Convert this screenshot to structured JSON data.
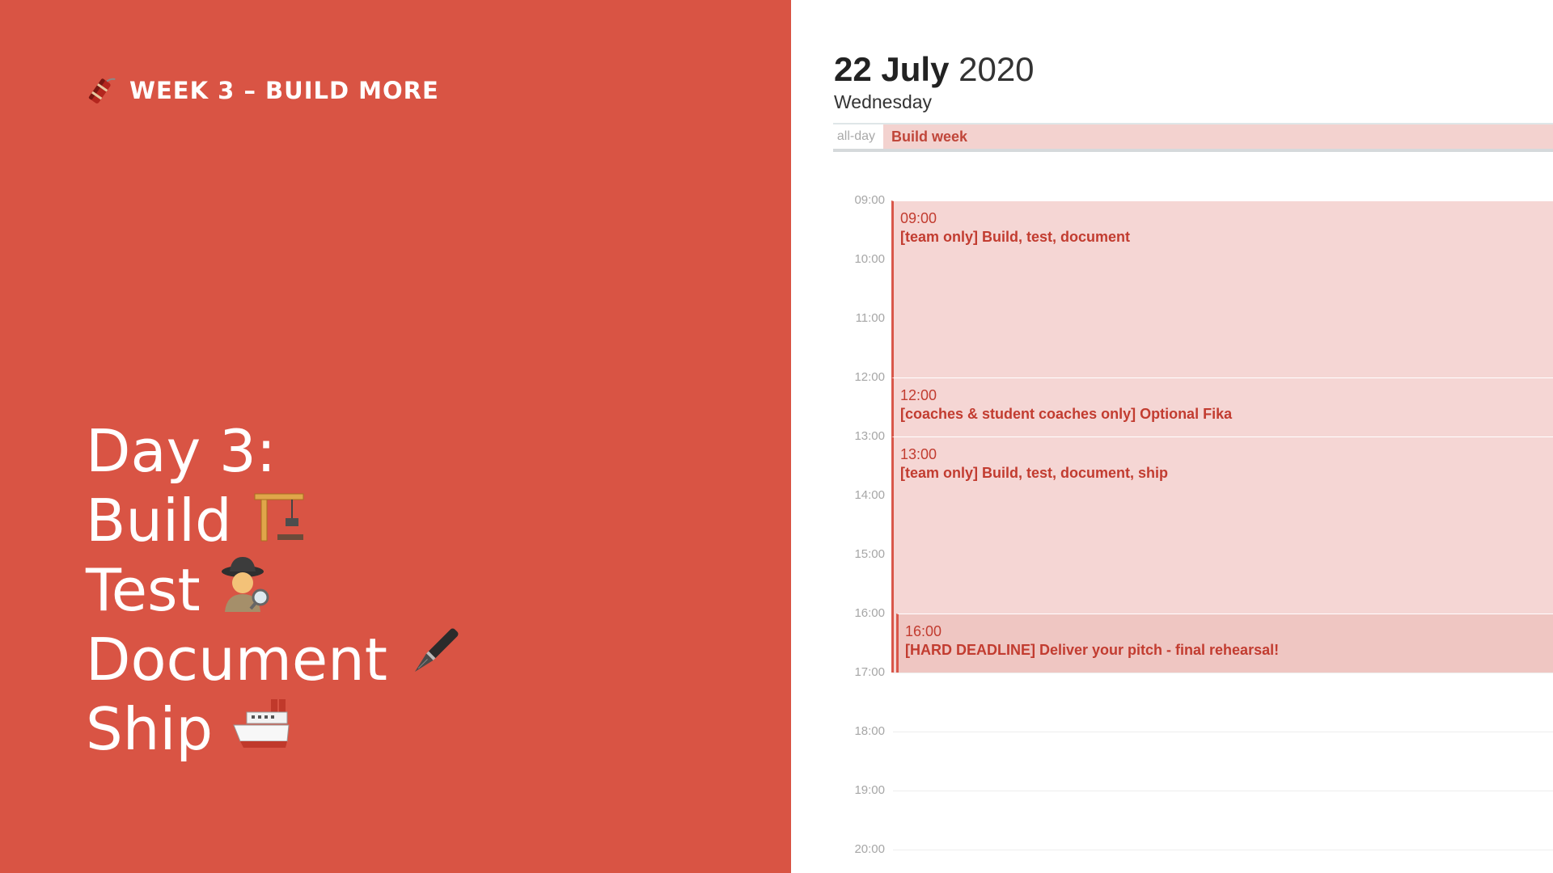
{
  "slide": {
    "week_heading": "WEEK 3 – BUILD MORE",
    "day_title": "Day 3:",
    "items": [
      {
        "label": "Build",
        "icon": "construction-crane-icon",
        "emoji": "🏗️"
      },
      {
        "label": "Test",
        "icon": "detective-icon",
        "emoji": "🕵️‍♀️"
      },
      {
        "label": "Document",
        "icon": "fountain-pen-icon",
        "emoji": "🖋️"
      },
      {
        "label": "Ship",
        "icon": "ship-icon",
        "emoji": "🛳️"
      }
    ],
    "heading_icon": "firecracker-icon",
    "background_color": "#d95444"
  },
  "calendar": {
    "date_bold": "22 July",
    "year": "2020",
    "weekday": "Wednesday",
    "allday_label": "all-day",
    "allday_event": "Build week",
    "hours": [
      "09:00",
      "10:00",
      "11:00",
      "12:00",
      "13:00",
      "14:00",
      "15:00",
      "16:00",
      "17:00",
      "18:00",
      "19:00",
      "20:00"
    ],
    "events": [
      {
        "time": "09:00",
        "title": "[team only] Build, test, document"
      },
      {
        "time": "12:00",
        "title": "[coaches & student coaches only] Optional Fika"
      },
      {
        "time": "13:00",
        "title": "[team only] Build, test, document, ship"
      },
      {
        "time": "16:00",
        "title": "[HARD DEADLINE] Deliver your pitch - final rehearsal!"
      }
    ],
    "event_color": "#f5d6d4",
    "event_text_color": "#c23c30"
  }
}
